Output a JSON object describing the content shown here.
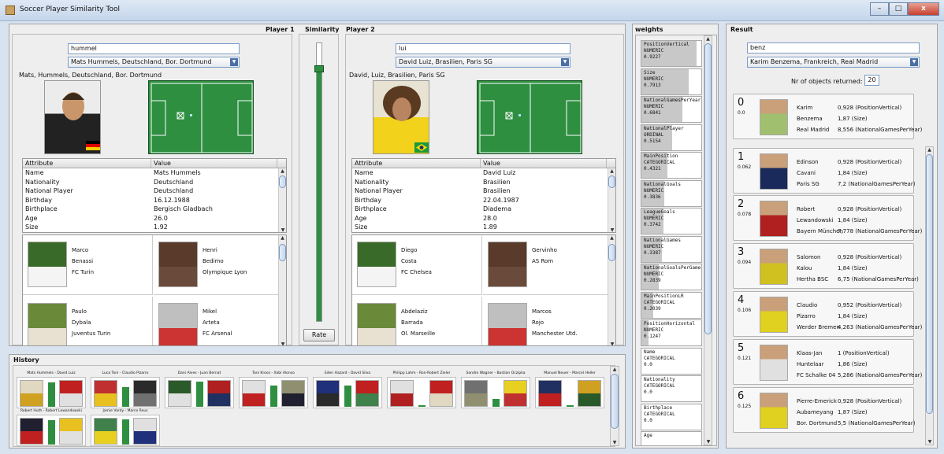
{
  "window": {
    "title": "Soccer Player Similarity Tool",
    "min": "–",
    "max": "□",
    "close": "x"
  },
  "compare": {
    "player1_title": "Player 1",
    "similarity_title": "Similarity",
    "player2_title": "Player 2",
    "rate_label": "Rate",
    "similarity_value": 0.91
  },
  "player1": {
    "search": "hummel",
    "selected": "Mats Hummels, Deutschland, Bor. Dortmund",
    "caption": "Mats, Hummels, Deutschland, Bor. Dortmund",
    "attributes": [
      [
        "Name",
        "Mats Hummels"
      ],
      [
        "Nationality",
        "Deutschland"
      ],
      [
        "National Player",
        "Deutschland"
      ],
      [
        "Birthday",
        "16.12.1988"
      ],
      [
        "Birthplace",
        "Bergisch Gladbach"
      ],
      [
        "Age",
        "26.0"
      ],
      [
        "Size",
        "1.92"
      ]
    ],
    "similar": [
      [
        "Marco",
        "Benassi",
        "FC Turin"
      ],
      [
        "Henri",
        "Bedimo",
        "Olympique Lyon"
      ],
      [
        "Paulo",
        "Dybala",
        "Juventus Turin"
      ],
      [
        "Mikel",
        "Arteta",
        "FC Arsenal"
      ]
    ]
  },
  "player2": {
    "search": "lui",
    "selected": "David Luiz, Brasilien, Paris SG",
    "caption": "David, Luiz, Brasilien, Paris SG",
    "attributes": [
      [
        "Name",
        "David Luiz"
      ],
      [
        "Nationality",
        "Brasilien"
      ],
      [
        "National Player",
        "Brasilien"
      ],
      [
        "Birthday",
        "22.04.1987"
      ],
      [
        "Birthplace",
        "Diadema"
      ],
      [
        "Age",
        "28.0"
      ],
      [
        "Size",
        "1.89"
      ]
    ],
    "similar": [
      [
        "Diego",
        "Costa",
        "FC Chelsea"
      ],
      [
        "Gervinho",
        "AS Rom",
        ""
      ],
      [
        "Abdelaziz",
        "Barrada",
        "Ol. Marseille"
      ],
      [
        "Marcos",
        "Rojo",
        "Manchester Utd."
      ]
    ]
  },
  "table_headers": {
    "attribute": "Attribute",
    "value": "Value"
  },
  "weights": {
    "title": "weights",
    "items": [
      {
        "name": "PositionVertical",
        "type": "NUMERIC",
        "value": "0.9227",
        "w": 0.9227
      },
      {
        "name": "Size",
        "type": "NUMERIC",
        "value": "0.7913",
        "w": 0.7913
      },
      {
        "name": "NationalGamesPerYear",
        "type": "NUMERIC",
        "value": "0.6841",
        "w": 0.6841
      },
      {
        "name": "NationalPlayer",
        "type": "ORDINAL",
        "value": "0.5154",
        "w": 0.5154
      },
      {
        "name": "MainPosition",
        "type": "CATEGORICAL",
        "value": "0.4321",
        "w": 0.4321
      },
      {
        "name": "NationalGoals",
        "type": "NUMERIC",
        "value": "0.3836",
        "w": 0.3836
      },
      {
        "name": "LeagueGoals",
        "type": "NUMERIC",
        "value": "0.3742",
        "w": 0.3742
      },
      {
        "name": "NationalGames",
        "type": "NUMERIC",
        "value": "0.3387",
        "w": 0.3387
      },
      {
        "name": "NationalGoalsPerGame",
        "type": "NUMERIC",
        "value": "0.2839",
        "w": 0.2839
      },
      {
        "name": "MainPositionLR",
        "type": "CATEGORICAL",
        "value": "0.2039",
        "w": 0.2039
      },
      {
        "name": "PositionHorizontal",
        "type": "NUMERIC",
        "value": "0.1247",
        "w": 0.1247
      },
      {
        "name": "Name",
        "type": "CATEGORICAL",
        "value": "0.0",
        "w": 0
      },
      {
        "name": "Nationality",
        "type": "CATEGORICAL",
        "value": "0.0",
        "w": 0
      },
      {
        "name": "Birthplace",
        "type": "CATEGORICAL",
        "value": "0.0",
        "w": 0
      },
      {
        "name": "Age",
        "type": "",
        "value": "",
        "w": 0
      }
    ]
  },
  "result": {
    "title": "Result",
    "search": "benz",
    "selected": "Karim Benzema, Frankreich, Real Madrid",
    "nr_label": "Nr of objects returned:",
    "nr_value": "20",
    "items": [
      {
        "rank": "0",
        "dist": "0.0",
        "first": "Karim",
        "last": "Benzema",
        "club": "Real Madrid",
        "a1": "0,928 (PositionVertical)",
        "a2": "1,87 (Size)",
        "a3": "8,556 (NationalGamesPerYear)"
      },
      {
        "rank": "1",
        "dist": "0.062",
        "first": "Edinson",
        "last": "Cavani",
        "club": "Paris SG",
        "a1": "0,928 (PositionVertical)",
        "a2": "1,84 (Size)",
        "a3": "7,2 (NationalGamesPerYear)"
      },
      {
        "rank": "2",
        "dist": "0.078",
        "first": "Robert",
        "last": "Lewandowski",
        "club": "Bayern München",
        "a1": "0,928 (PositionVertical)",
        "a2": "1,84 (Size)",
        "a3": "7,778 (NationalGamesPerYear)"
      },
      {
        "rank": "3",
        "dist": "0.094",
        "first": "Salomon",
        "last": "Kalou",
        "club": "Hertha BSC",
        "a1": "0,928 (PositionVertical)",
        "a2": "1,84 (Size)",
        "a3": "6,75 (NationalGamesPerYear)"
      },
      {
        "rank": "4",
        "dist": "0.106",
        "first": "Claudio",
        "last": "Pizarro",
        "club": "Werder Bremen",
        "a1": "0,952 (PositionVertical)",
        "a2": "1,84 (Size)",
        "a3": "4,263 (NationalGamesPerYear)"
      },
      {
        "rank": "5",
        "dist": "0.121",
        "first": "Klaas-Jan",
        "last": "Huntelaar",
        "club": "FC Schalke 04",
        "a1": "1 (PositionVertical)",
        "a2": "1,86 (Size)",
        "a3": "5,286 (NationalGamesPerYear)"
      },
      {
        "rank": "6",
        "dist": "0.125",
        "first": "Pierre-Emerick",
        "last": "Aubameyang",
        "club": "Bor. Dortmund",
        "a1": "0,928 (PositionVertical)",
        "a2": "1,87 (Size)",
        "a3": "5,5 (NationalGamesPerYear)"
      }
    ]
  },
  "history": {
    "title": "History",
    "items": [
      {
        "label": "Mats Hummels - David Luiz",
        "sim": 0.92
      },
      {
        "label": "Luca Toni - Claudio Pizarro",
        "sim": 0.75
      },
      {
        "label": "Dani Alves - Juan Bernat",
        "sim": 0.95
      },
      {
        "label": "Toni Kroos - Xabi Alonso",
        "sim": 0.8
      },
      {
        "label": "Eden Hazard - David Silva",
        "sim": 0.78
      },
      {
        "label": "Philipp Lahm - Ron-Robert Zieler",
        "sim": 0.05
      },
      {
        "label": "Sandro Wagner - Bastian Oczipka",
        "sim": 0.3
      },
      {
        "label": "Manuel Neuer - Marcel Heller",
        "sim": 0.05
      },
      {
        "label": "Robert Huth - Robert Lewandowski",
        "sim": 0.9
      },
      {
        "label": "Jamie Vardy - Marco Reus",
        "sim": 0.95
      }
    ]
  }
}
